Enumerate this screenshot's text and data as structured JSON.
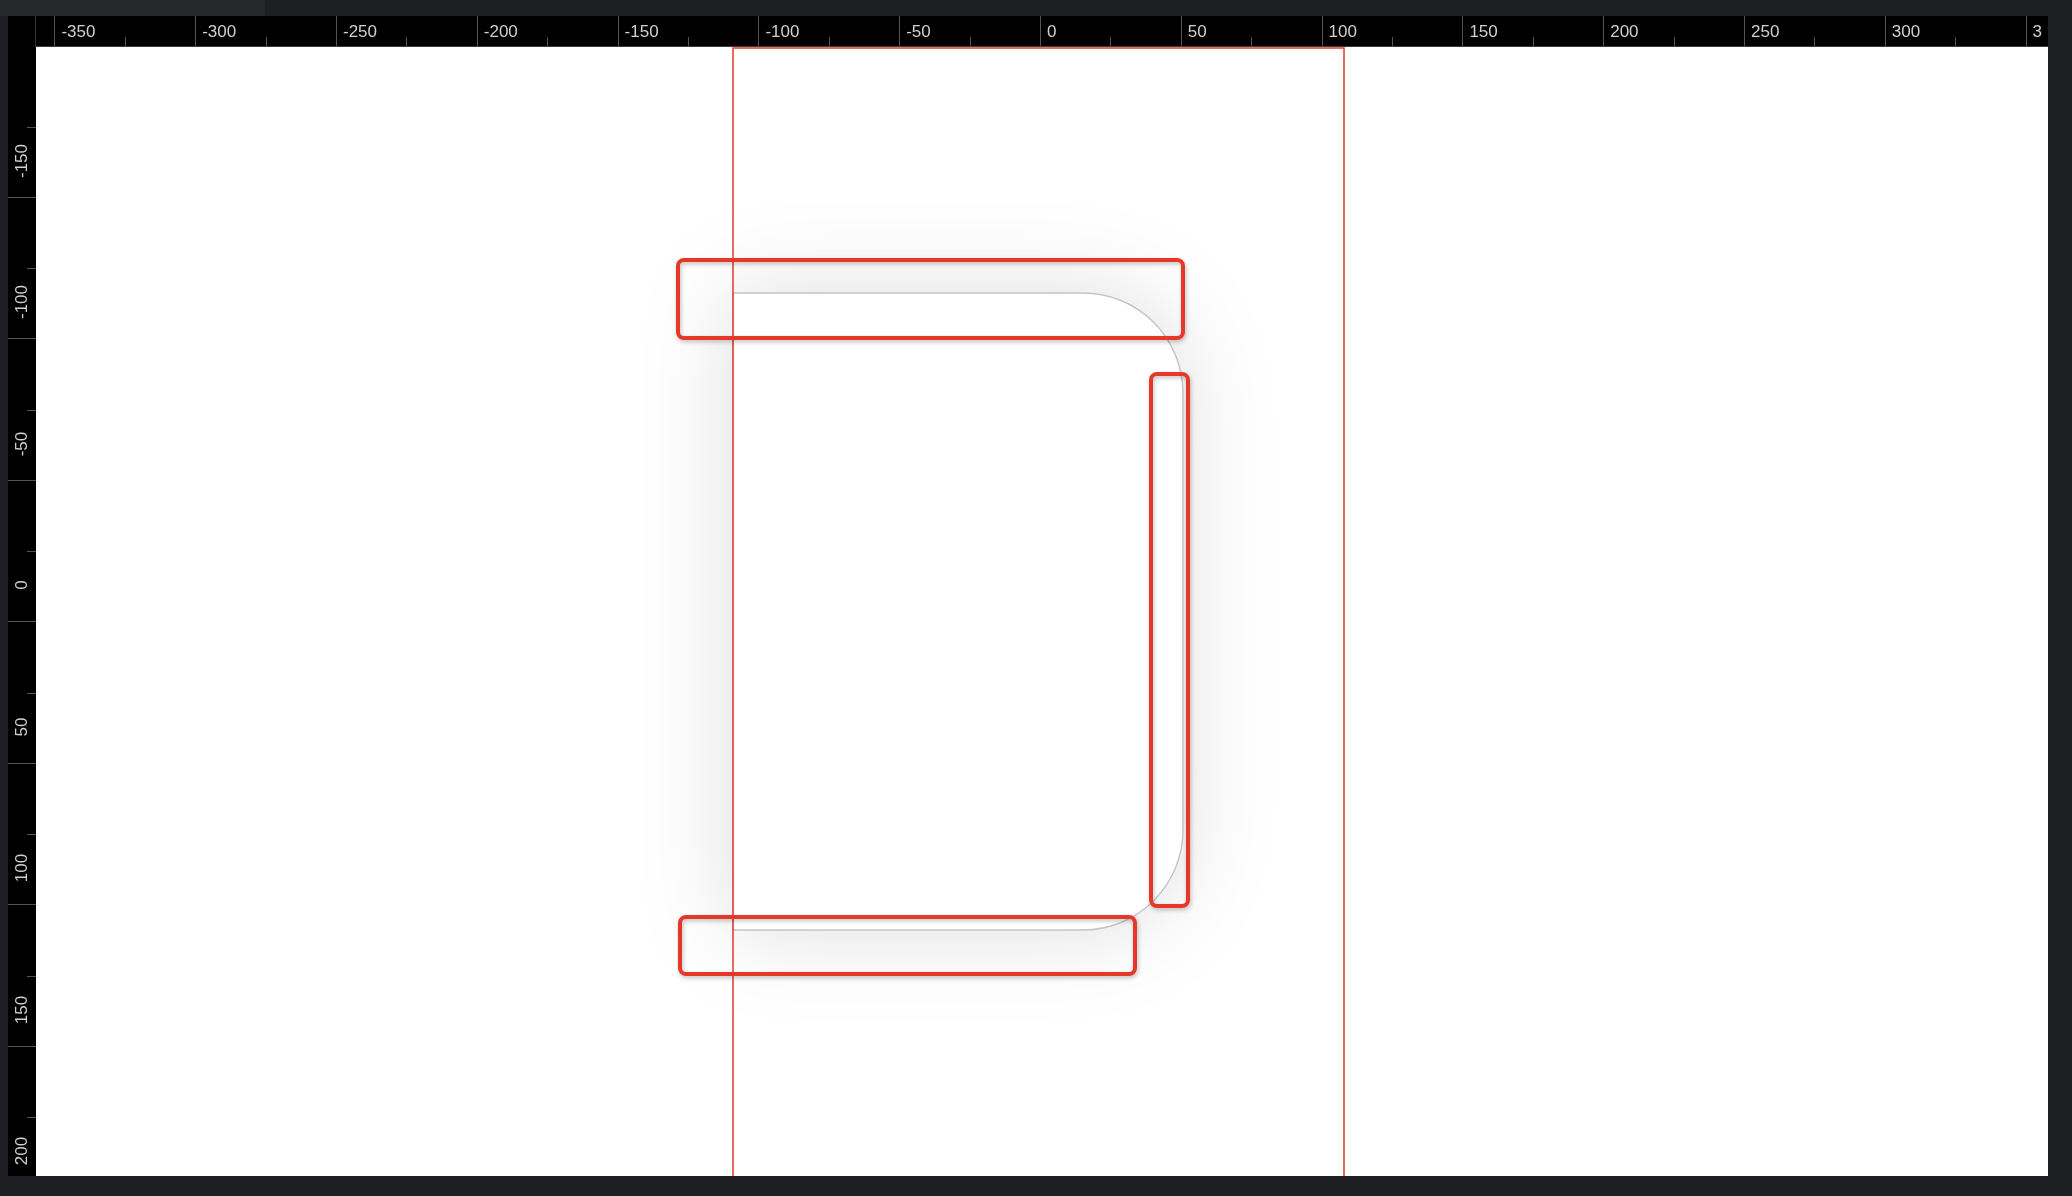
{
  "rulers": {
    "horizontal_labels": [
      "-350",
      "-300",
      "-250",
      "-200",
      "-150",
      "-100",
      "-50",
      "0",
      "50",
      "100",
      "150",
      "200",
      "250",
      "300",
      "3"
    ],
    "vertical_labels": [
      "-150",
      "-100",
      "-50",
      "0",
      "50",
      "100",
      "150",
      "200"
    ]
  }
}
